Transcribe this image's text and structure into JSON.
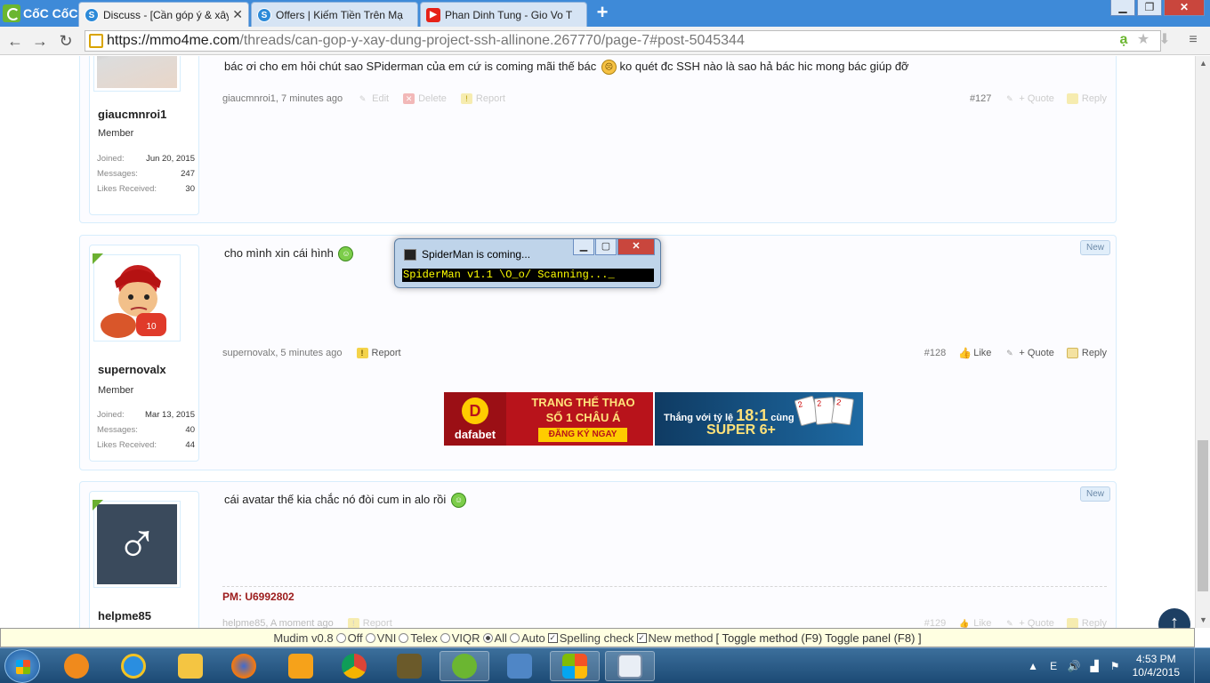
{
  "browser": {
    "brand": "CốC CốC",
    "tabs": [
      {
        "title": "Discuss - [Cần góp ý & xây",
        "favicon": "s",
        "active": true
      },
      {
        "title": "Offers | Kiếm Tiền Trên Mạ",
        "favicon": "s",
        "active": false
      },
      {
        "title": "Phan Dinh Tung - Gio Vo T",
        "favicon": "youtube-icon",
        "active": false
      }
    ],
    "url_host": "https://mmo4me.com",
    "url_path": "/threads/can-gop-y-xay-dung-project-ssh-allinone.267770/page-7#post-5045344",
    "colors": {
      "tabbar": "#3e8ad8",
      "brand_green": "#6bb631"
    }
  },
  "posts": [
    {
      "username": "giaucmnroi1",
      "title": "Member",
      "stats": [
        {
          "label": "Joined:",
          "value": "Jun 20, 2015"
        },
        {
          "label": "Messages:",
          "value": "247"
        },
        {
          "label": "Likes Received:",
          "value": "30"
        }
      ],
      "message": "bác ơi cho em hỏi chút sao SPiderman của em cứ is coming mãi thế bác",
      "message_tail": "ko quét đc SSH nào là sao hả bác hic mong bác giúp đỡ",
      "meta": "giaucmnroi1, 7 minutes ago",
      "actions_left": [
        "Edit",
        "Delete",
        "Report"
      ],
      "number": "#127",
      "actions_right": [
        "+ Quote",
        "Reply"
      ]
    },
    {
      "username": "supernovalx",
      "title": "Member",
      "stats": [
        {
          "label": "Joined:",
          "value": "Mar 13, 2015"
        },
        {
          "label": "Messages:",
          "value": "40"
        },
        {
          "label": "Likes Received:",
          "value": "44"
        }
      ],
      "message": "cho mình xin cái hình",
      "meta": "supernovalx, 5 minutes ago",
      "actions_left": [
        "Report"
      ],
      "number": "#128",
      "actions_right": [
        "Like",
        "+ Quote",
        "Reply"
      ],
      "new_tag": "New",
      "banners": {
        "left": {
          "brand": "dafabet",
          "line1": "TRANG THỂ THAO",
          "line2": "SỐ 1 CHÂU Á",
          "cta": "ĐĂNG KÝ NGAY"
        },
        "right": {
          "line1": "Thắng với tỷ lệ",
          "ratio": "18:1",
          "line1b": "cùng",
          "line2": "SUPER 6+"
        }
      }
    },
    {
      "username": "helpme85",
      "avatar_symbol": "♂",
      "message": "cái avatar thế kia chắc nó đòi cum in alo rồi",
      "pm": "PM: U6992802",
      "meta": "helpme85, A moment ago",
      "actions_left": [
        "Report"
      ],
      "number": "#129",
      "actions_right": [
        "Like",
        "+ Quote",
        "Reply"
      ],
      "new_tag": "New"
    }
  ],
  "console": {
    "title": "SpiderMan is coming...",
    "output": "SpiderMan v1.1 \\O_o/ Scanning..._"
  },
  "mudim": {
    "version": "Mudim v0.8",
    "modes": [
      {
        "label": "Off",
        "checked": false
      },
      {
        "label": "VNI",
        "checked": false
      },
      {
        "label": "Telex",
        "checked": false
      },
      {
        "label": "VIQR",
        "checked": false
      },
      {
        "label": "All",
        "checked": true
      },
      {
        "label": "Auto",
        "checked": false
      }
    ],
    "spelling_check": "Spelling check",
    "new_method": "New method",
    "toggle_method": "[ Toggle method (F9)",
    "toggle_panel": "Toggle panel (F8) ]"
  },
  "taskbar": {
    "time": "4:53 PM",
    "date": "10/4/2015"
  }
}
